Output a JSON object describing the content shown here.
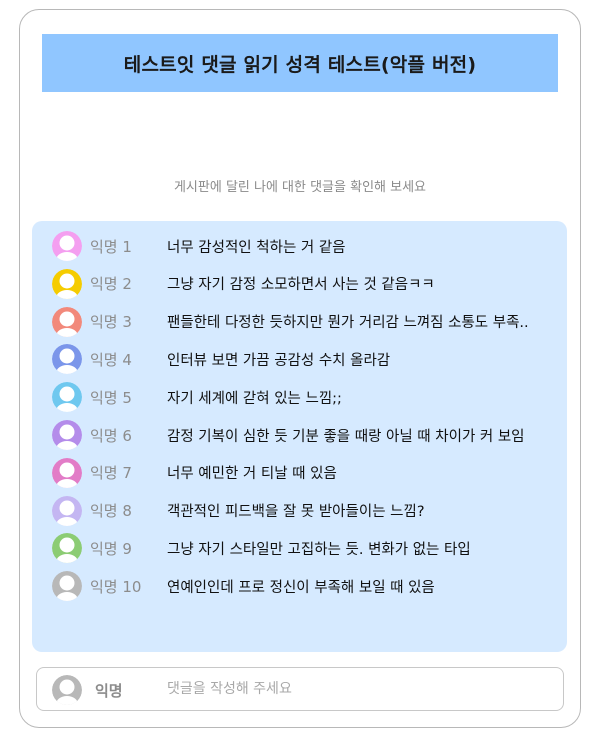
{
  "header": {
    "title": "테스트잇 댓글 읽기 성격 테스트(악플 버전)"
  },
  "subtitle": "게시판에 달린 나에 대한 댓글을 확인해 보세요",
  "comments": [
    {
      "nickname": "익명 1",
      "text": "너무 감성적인 척하는 거 같음",
      "avatar_color": "#f49ff0",
      "avatar_icon": "user-avatar-icon"
    },
    {
      "nickname": "익명 2",
      "text": "그냥 자기 감정 소모하면서 사는 것 같음ㅋㅋ",
      "avatar_color": "#f5cc00",
      "avatar_icon": "user-avatar-icon"
    },
    {
      "nickname": "익명 3",
      "text": "팬들한테 다정한 듯하지만 뭔가 거리감 느껴짐 소통도 부족..",
      "avatar_color": "#f2897b",
      "avatar_icon": "user-avatar-icon"
    },
    {
      "nickname": "익명 4",
      "text": "인터뷰 보면 가끔 공감성 수치 올라감",
      "avatar_color": "#7b96ea",
      "avatar_icon": "user-avatar-icon"
    },
    {
      "nickname": "익명 5",
      "text": "자기 세계에 갇혀 있는 느낌;;",
      "avatar_color": "#6fc8ef",
      "avatar_icon": "user-avatar-icon"
    },
    {
      "nickname": "익명 6",
      "text": "감정 기복이 심한 듯 기분 좋을 때랑 아닐 때 차이가 커 보임",
      "avatar_color": "#b48cea",
      "avatar_icon": "user-avatar-icon"
    },
    {
      "nickname": "익명 7",
      "text": "너무 예민한 거 티날 때 있음",
      "avatar_color": "#e27cc7",
      "avatar_icon": "user-avatar-icon"
    },
    {
      "nickname": "익명 8",
      "text": "객관적인 피드백을 잘 못 받아들이는 느낌?",
      "avatar_color": "#c4b6f2",
      "avatar_icon": "user-avatar-icon"
    },
    {
      "nickname": "익명 9",
      "text": "그냥 자기 스타일만 고집하는 듯. 변화가 없는 타입",
      "avatar_color": "#8ccc74",
      "avatar_icon": "user-avatar-icon"
    },
    {
      "nickname": "익명 10",
      "text": "연예인인데 프로 정신이 부족해 보일 때 있음",
      "avatar_color": "#b8b8b8",
      "avatar_icon": "user-avatar-icon"
    }
  ],
  "comment_input": {
    "nickname": "익명",
    "placeholder": "댓글을 작성해 주세요",
    "avatar_color": "#b8b8b8",
    "avatar_icon": "user-avatar-icon"
  },
  "colors": {
    "title_bar": "#90c6ff",
    "comment_panel": "#d6eaff"
  }
}
